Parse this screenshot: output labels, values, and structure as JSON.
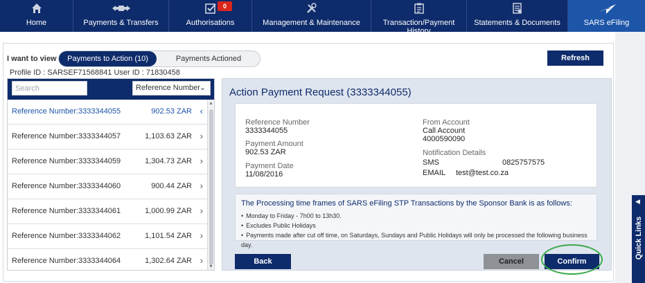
{
  "nav": {
    "items": [
      {
        "label": "Home",
        "icon": "home-icon"
      },
      {
        "label": "Payments & Transfers",
        "icon": "payments-icon"
      },
      {
        "label": "Authorisations",
        "icon": "checkbox-icon",
        "badge": "0"
      },
      {
        "label": "Management & Maintenance",
        "icon": "tools-icon"
      },
      {
        "label": "Transaction/Payment History",
        "icon": "clipboard-icon"
      },
      {
        "label": "Statements & Documents",
        "icon": "document-icon"
      },
      {
        "label": "SARS eFiling",
        "icon": "sars-logo-icon",
        "active": true
      }
    ]
  },
  "view": {
    "label": "I want to view",
    "active_tab": "Payments to Action  (10)",
    "inactive_tab": "Payments Actioned",
    "refresh": "Refresh"
  },
  "profile": {
    "profile_label": "Profile ID :",
    "profile_id": "SARSEF71568841",
    "user_label": "User ID :",
    "user_id": "71830458"
  },
  "list": {
    "search_placeholder": "Search",
    "sort_value": "Reference Number",
    "rows": [
      {
        "ref": "Reference Number:3333344055",
        "amount": "902.53 ZAR",
        "selected": true
      },
      {
        "ref": "Reference Number:3333344057",
        "amount": "1,103.63 ZAR"
      },
      {
        "ref": "Reference Number:3333344059",
        "amount": "1,304.73 ZAR"
      },
      {
        "ref": "Reference Number:3333344060",
        "amount": "900.44 ZAR"
      },
      {
        "ref": "Reference Number:3333344061",
        "amount": "1,000.99 ZAR"
      },
      {
        "ref": "Reference Number:3333344062",
        "amount": "1,101.54 ZAR"
      },
      {
        "ref": "Reference Number:3333344064",
        "amount": "1,302.64 ZAR"
      }
    ]
  },
  "detail": {
    "title": "Action Payment Request (3333344055)",
    "reference_label": "Reference Number",
    "reference_value": "3333344055",
    "amount_label": "Payment Amount",
    "amount_value": "902.53 ZAR",
    "date_label": "Payment Date",
    "date_value": "11/08/2016",
    "from_label": "From Account",
    "from_name": "Call Account",
    "from_number": "4000590090",
    "notif_label": "Notification Details",
    "sms_label": "SMS",
    "sms_value": "0825757575",
    "email_label": "EMAIL",
    "email_value": "test@test.co.za"
  },
  "info": {
    "title": "The Processing time frames of SARS eFiling STP Transactions by the Sponsor Bank is as follows:",
    "bullets": [
      "Monday to Friday - 7h00 to 13h30.",
      "Excludes Public Holidays",
      "Payments made after cut off time, on Saturdays, Sundays and Public Holidays will only be processed the following business day."
    ]
  },
  "buttons": {
    "back": "Back",
    "cancel": "Cancel",
    "confirm": "Confirm"
  },
  "quick_links": "Quick Links",
  "colors": {
    "navy": "#0e2b6b",
    "active_blue": "#1d55a8",
    "badge_red": "#d9261c",
    "highlight_green": "#3aa94a"
  }
}
